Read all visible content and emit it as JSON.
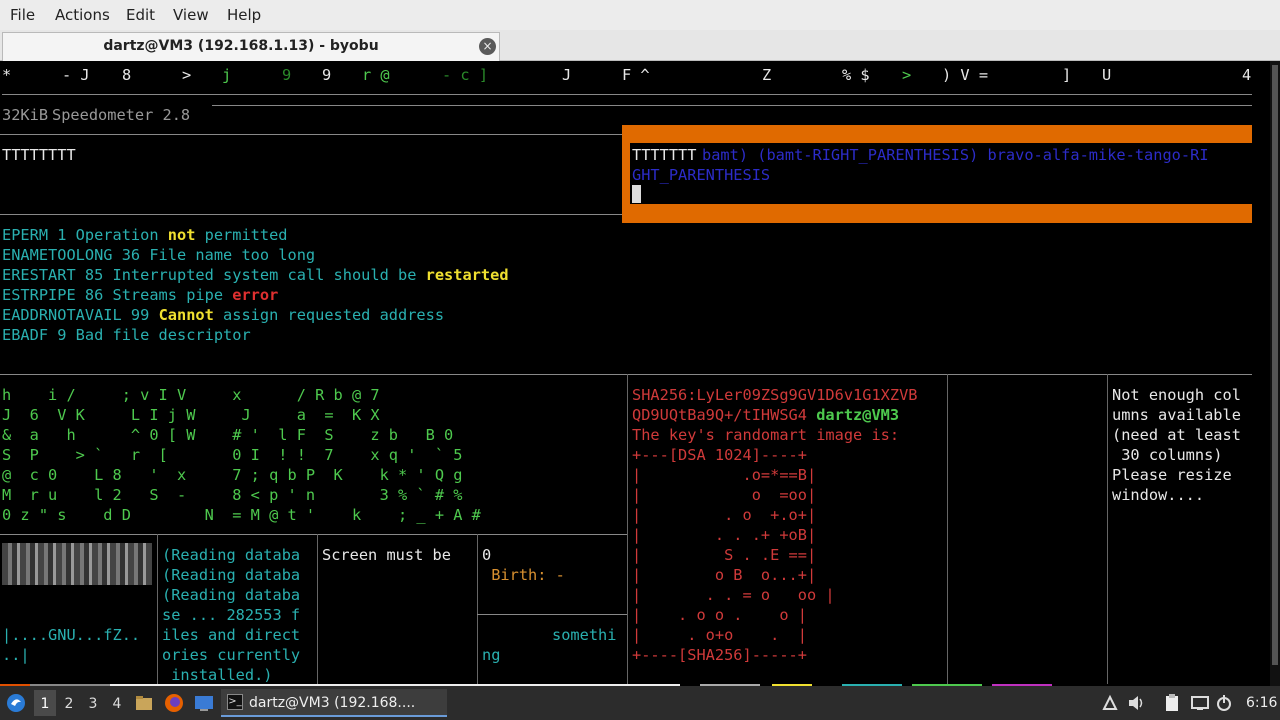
{
  "menu": {
    "file": "File",
    "actions": "Actions",
    "edit": "Edit",
    "view": "View",
    "help": "Help"
  },
  "tab": {
    "title": "dartz@VM3 (192.168.1.13) - byobu",
    "close": "×"
  },
  "terminal": {
    "top_row": [
      "*",
      "- J",
      "8",
      ">",
      "j",
      "9",
      "9",
      "r @",
      "- c ]",
      "J",
      "F ^",
      "Z",
      "% $",
      ">",
      ") V =",
      "]",
      "U",
      "4"
    ],
    "speed": {
      "rate": "32KiB",
      "title": "Speedometer 2.8"
    },
    "t_left": "TTTTTTTT",
    "popup": {
      "prefix": "TTTTTTT",
      "line1": "bamt) (bamt-RIGHT_PARENTHESIS) bravo-alfa-mike-tango-RI",
      "line2": "GHT_PARENTHESIS"
    },
    "errno": [
      {
        "a": "EPERM 1 Operation ",
        "b": "not",
        "c": " permitted"
      },
      {
        "a": "ENAMETOOLONG 36 File name too long",
        "b": "",
        "c": ""
      },
      {
        "a": "ERESTART 85 Interrupted system call should be ",
        "b": "restarted",
        "c": ""
      },
      {
        "a": "ESTRPIPE 86 Streams pipe ",
        "b": "error",
        "c": ""
      },
      {
        "a": "EADDRNOTAVAIL 99 ",
        "b": "Cannot",
        "c": " assign requested address"
      },
      {
        "a": "EBADF 9 Bad file descriptor",
        "b": "",
        "c": ""
      }
    ],
    "matrix_rows": [
      "h    i /     ; v I V     x      / R b @ 7",
      "J  6  V K     L I j W     J     a  =  K X",
      "&  a   h      ^ 0 [ W    # '  l F  S    z b   B 0",
      "S  P    > `   r  [       0 I  ! !  7    x q '  ` 5",
      "@  c 0    L 8   '  x     7 ; q b P  K    k * ' Q g",
      "M  r u    l 2   S  -     8 < p ' n       3 % ` # %",
      "0 z \" s    d D        N  = M @ t '    k    ; _ + A #"
    ],
    "apt": [
      "(Reading databa",
      "(Reading databa",
      "(Reading databa",
      "se ... 282553 f",
      "iles and direct",
      "ories currently",
      " installed.)"
    ],
    "hex": [
      "|....GNU...fZ..",
      "..|"
    ],
    "screen_msg": "Screen must be",
    "zero": "0",
    "birth": " Birth: -",
    "somethi": "somethi",
    "ng": "ng",
    "sha": {
      "line1": "SHA256:LyLer09ZSg9GV1D6v1G1XZVB",
      "line2a": "QD9UQtBa9Q+/tIHWSG4 ",
      "user": "dartz@VM3",
      "line3": "The key's randomart image is:",
      "art": [
        "+---[DSA 1024]----+",
        "|           .o=*==B|",
        "|            o  =oo|",
        "|         . o  +.o+|",
        "|        . . .+ +oB|",
        "|         S . .E ==|",
        "|        o B  o...+|",
        "|       . . = o   oo |",
        "|    . o o .    o |",
        "|     . o+o    .  |",
        "+----[SHA256]-----+"
      ]
    },
    "resize": [
      "Not enough col",
      "umns available",
      "(need at least",
      " 30 columns)",
      "Please resize",
      "window...."
    ]
  },
  "taskbar": {
    "workspaces": [
      "1",
      "2",
      "3",
      "4"
    ],
    "task": "dartz@VM3 (192.168....",
    "clock": "6:16"
  }
}
